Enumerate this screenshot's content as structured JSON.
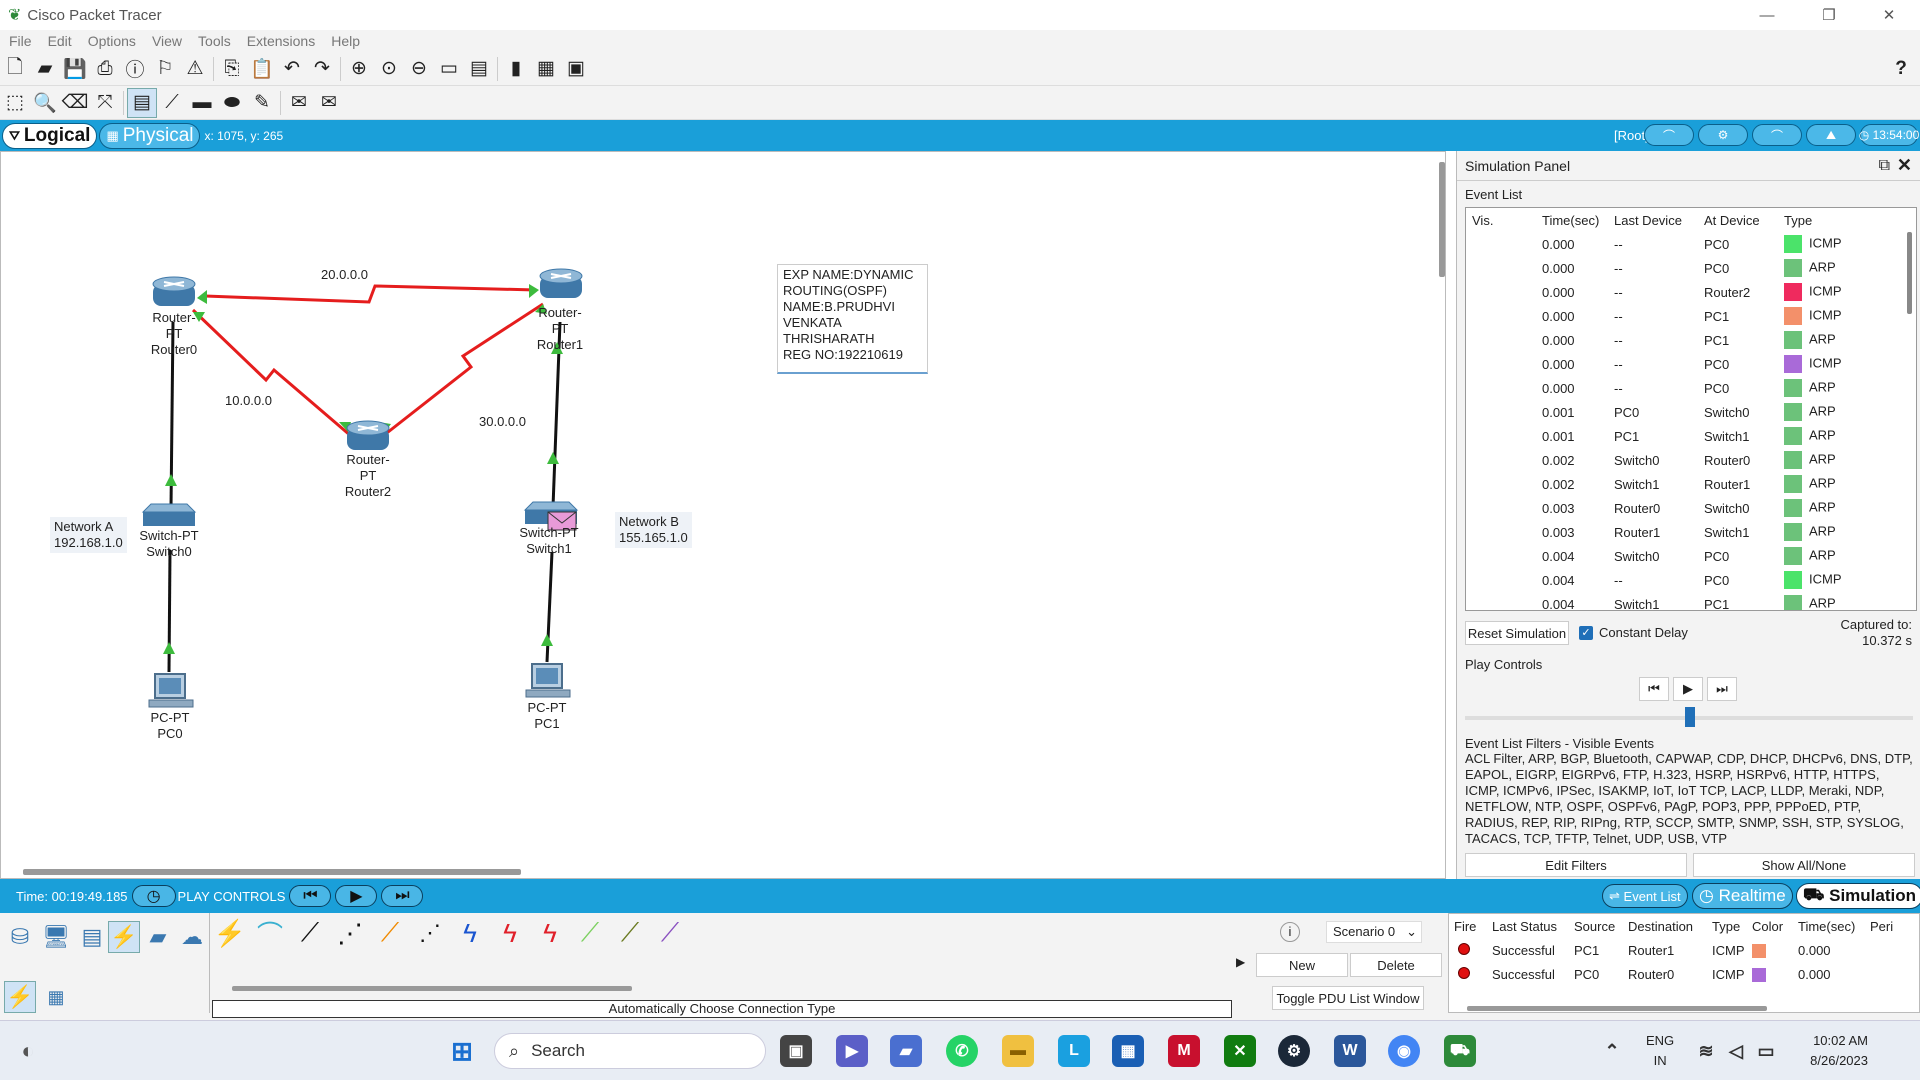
{
  "window": {
    "title": "Cisco Packet Tracer"
  },
  "menu": [
    "File",
    "Edit",
    "Options",
    "View",
    "Tools",
    "Extensions",
    "Help"
  ],
  "toolbar": {
    "help": "?"
  },
  "workspace_tabs": {
    "logical": "Logical",
    "physical": "Physical",
    "coords": "x: 1075, y: 265",
    "root": "[Root]",
    "clock": "13:54:00"
  },
  "devices": {
    "router0": {
      "type": "Router-PT",
      "name": "Router0"
    },
    "router1": {
      "type": "Router-PT",
      "name": "Router1"
    },
    "router2": {
      "type": "Router-PT",
      "name": "Router2"
    },
    "switch0": {
      "type": "Switch-PT",
      "name": "Switch0"
    },
    "switch1": {
      "type": "Switch-PT",
      "name": "Switch1"
    },
    "pc0": {
      "type": "PC-PT",
      "name": "PC0"
    },
    "pc1": {
      "type": "PC-PT",
      "name": "PC1"
    }
  },
  "links": {
    "r0_r1": "20.0.0.0",
    "r0_r2": "10.0.0.0",
    "r1_r2": "30.0.0.0"
  },
  "networks": {
    "a": {
      "name": "Network A",
      "addr": "192.168.1.0"
    },
    "b": {
      "name": "Network B",
      "addr": "155.165.1.0"
    }
  },
  "note": [
    "EXP NAME:DYNAMIC",
    "ROUTING(OSPF)",
    "NAME:B.PRUDHVI",
    "VENKATA",
    "THRISHARATH",
    "REG NO:192210619"
  ],
  "sim": {
    "panel_title": "Simulation Panel",
    "event_list_label": "Event List",
    "headers": [
      "Vis.",
      "Time(sec)",
      "Last Device",
      "At Device",
      "Type"
    ],
    "events": [
      {
        "time": "0.000",
        "last": "--",
        "at": "PC0",
        "color": "#4be36a",
        "type": "ICMP"
      },
      {
        "time": "0.000",
        "last": "--",
        "at": "PC0",
        "color": "#6cc27a",
        "type": "ARP"
      },
      {
        "time": "0.000",
        "last": "--",
        "at": "Router2",
        "color": "#ef2a5e",
        "type": "ICMP"
      },
      {
        "time": "0.000",
        "last": "--",
        "at": "PC1",
        "color": "#f3906a",
        "type": "ICMP"
      },
      {
        "time": "0.000",
        "last": "--",
        "at": "PC1",
        "color": "#6cc27a",
        "type": "ARP"
      },
      {
        "time": "0.000",
        "last": "--",
        "at": "PC0",
        "color": "#a96ad8",
        "type": "ICMP"
      },
      {
        "time": "0.000",
        "last": "--",
        "at": "PC0",
        "color": "#6cc27a",
        "type": "ARP"
      },
      {
        "time": "0.001",
        "last": "PC0",
        "at": "Switch0",
        "color": "#6cc27a",
        "type": "ARP"
      },
      {
        "time": "0.001",
        "last": "PC1",
        "at": "Switch1",
        "color": "#6cc27a",
        "type": "ARP"
      },
      {
        "time": "0.002",
        "last": "Switch0",
        "at": "Router0",
        "color": "#6cc27a",
        "type": "ARP"
      },
      {
        "time": "0.002",
        "last": "Switch1",
        "at": "Router1",
        "color": "#6cc27a",
        "type": "ARP"
      },
      {
        "time": "0.003",
        "last": "Router0",
        "at": "Switch0",
        "color": "#6cc27a",
        "type": "ARP"
      },
      {
        "time": "0.003",
        "last": "Router1",
        "at": "Switch1",
        "color": "#6cc27a",
        "type": "ARP"
      },
      {
        "time": "0.004",
        "last": "Switch0",
        "at": "PC0",
        "color": "#6cc27a",
        "type": "ARP"
      },
      {
        "time": "0.004",
        "last": "--",
        "at": "PC0",
        "color": "#4be36a",
        "type": "ICMP"
      },
      {
        "time": "0.004",
        "last": "Switch1",
        "at": "PC1",
        "color": "#6cc27a",
        "type": "ARP"
      }
    ],
    "reset": "Reset Simulation",
    "constant_delay": "Constant Delay",
    "captured_label": "Captured to:",
    "captured_value": "10.372 s",
    "play_controls": "Play Controls",
    "filters_label": "Event List Filters - Visible Events",
    "filters": "ACL Filter, ARP, BGP, Bluetooth, CAPWAP, CDP, DHCP, DHCPv6, DNS, DTP, EAPOL, EIGRP, EIGRPv6, FTP, H.323, HSRP, HSRPv6, HTTP, HTTPS, ICMP, ICMPv6, IPSec, ISAKMP, IoT, IoT TCP, LACP, LLDP, Meraki, NDP, NETFLOW, NTP, OSPF, OSPFv6, PAgP, POP3, PPP, PPPoED, PTP, RADIUS, REP, RIP, RIPng, RTP, SCCP, SMTP, SNMP, SSH, STP, SYSLOG, TACACS, TCP, TFTP, Telnet, UDP, USB, VTP",
    "edit_filters": "Edit Filters",
    "show_all": "Show All/None"
  },
  "status": {
    "time": "Time: 00:19:49.185",
    "play_controls": "PLAY CONTROLS",
    "event_list": "Event List",
    "realtime": "Realtime",
    "simulation": "Simulation"
  },
  "bottom": {
    "connection_type": "Automatically Choose Connection Type",
    "scenario": "Scenario 0",
    "new": "New",
    "delete": "Delete",
    "toggle": "Toggle PDU List Window"
  },
  "pdu": {
    "headers": [
      "Fire",
      "Last Status",
      "Source",
      "Destination",
      "Type",
      "Color",
      "Time(sec)",
      "Peri"
    ],
    "rows": [
      {
        "status": "Successful",
        "source": "PC1",
        "dest": "Router1",
        "type": "ICMP",
        "color": "#f3906a",
        "time": "0.000"
      },
      {
        "status": "Successful",
        "source": "PC0",
        "dest": "Router0",
        "type": "ICMP",
        "color": "#a96ad8",
        "time": "0.000"
      }
    ]
  },
  "taskbar": {
    "search": "Search",
    "lang1": "ENG",
    "lang2": "IN",
    "time": "10:02 AM",
    "date": "8/26/2023"
  }
}
